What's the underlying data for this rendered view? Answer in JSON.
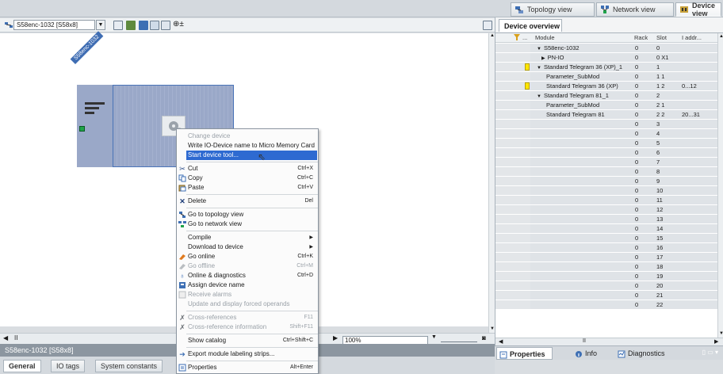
{
  "view_tabs": [
    {
      "label": "Topology view",
      "icon": "topology-icon",
      "active": false
    },
    {
      "label": "Network view",
      "icon": "network-icon",
      "active": false
    },
    {
      "label": "Device view",
      "icon": "device-icon",
      "active": true
    }
  ],
  "toolbar": {
    "device_selector": "S58enc-1032 [S58x8]",
    "icons": [
      "topology-icon",
      "overview-icon",
      "network-icon",
      "grid-icon",
      "table-icon",
      "layout-icon",
      "zoom-icon"
    ]
  },
  "canvas": {
    "device_name": "S58enc-1032",
    "zoom_value": "100%"
  },
  "context_menu": [
    {
      "label": "Change device",
      "disabled": true,
      "icon": "",
      "shortcut": ""
    },
    {
      "label": "Write IO-Device name to Micro Memory Card",
      "disabled": false,
      "icon": "",
      "shortcut": ""
    },
    {
      "label": "Start device tool...",
      "disabled": false,
      "icon": "",
      "shortcut": "",
      "highlighted": true
    },
    {
      "label": "Cut",
      "disabled": false,
      "icon": "cut-icon",
      "shortcut": "Ctrl+X"
    },
    {
      "label": "Copy",
      "disabled": false,
      "icon": "copy-icon",
      "shortcut": "Ctrl+C"
    },
    {
      "label": "Paste",
      "disabled": false,
      "icon": "paste-icon",
      "shortcut": "Ctrl+V"
    },
    {
      "label": "Delete",
      "disabled": false,
      "icon": "delete-icon",
      "shortcut": "Del"
    },
    {
      "label": "Go to topology view",
      "disabled": false,
      "icon": "topology-icon",
      "shortcut": ""
    },
    {
      "label": "Go to network view",
      "disabled": false,
      "icon": "network-icon",
      "shortcut": ""
    },
    {
      "label": "Compile",
      "disabled": false,
      "icon": "",
      "shortcut": "",
      "submenu": true
    },
    {
      "label": "Download to device",
      "disabled": false,
      "icon": "",
      "shortcut": "",
      "submenu": true
    },
    {
      "label": "Go online",
      "disabled": false,
      "icon": "go-online-icon",
      "shortcut": "Ctrl+K"
    },
    {
      "label": "Go offline",
      "disabled": true,
      "icon": "go-offline-icon",
      "shortcut": "Ctrl+M"
    },
    {
      "label": "Online & diagnostics",
      "disabled": false,
      "icon": "diagnostics-icon",
      "shortcut": "Ctrl+D"
    },
    {
      "label": "Assign device name",
      "disabled": false,
      "icon": "assign-name-icon",
      "shortcut": ""
    },
    {
      "label": "Receive alarms",
      "disabled": true,
      "icon": "alarm-icon",
      "shortcut": ""
    },
    {
      "label": "Update and display forced operands",
      "disabled": true,
      "icon": "",
      "shortcut": ""
    },
    {
      "label": "Cross-references",
      "disabled": true,
      "icon": "cross-ref-icon",
      "shortcut": "F11"
    },
    {
      "label": "Cross-reference information",
      "disabled": true,
      "icon": "cross-ref-info-icon",
      "shortcut": "Shift+F11"
    },
    {
      "label": "Show catalog",
      "disabled": false,
      "icon": "",
      "shortcut": "Ctrl+Shift+C"
    },
    {
      "label": "Export module labeling strips...",
      "disabled": false,
      "icon": "export-icon",
      "shortcut": ""
    },
    {
      "label": "Properties",
      "disabled": false,
      "icon": "properties-icon",
      "shortcut": "Alt+Enter"
    }
  ],
  "device_overview": {
    "tab_label": "Device overview",
    "columns": [
      "...",
      "Module",
      "Rack",
      "Slot",
      "I addr..."
    ],
    "rows": [
      {
        "module": "S58enc-1032",
        "rack": "0",
        "slot": "0",
        "addr": "",
        "indent": 1,
        "expander": "▼",
        "flag": false
      },
      {
        "module": "PN-IO",
        "rack": "0",
        "slot": "0 X1",
        "addr": "",
        "indent": 2,
        "expander": "▶",
        "flag": false
      },
      {
        "module": "Standard Telegram 36 (XP)_1",
        "rack": "0",
        "slot": "1",
        "addr": "",
        "indent": 1,
        "expander": "▼",
        "flag": true
      },
      {
        "module": "Parameter_SubMod",
        "rack": "0",
        "slot": "1 1",
        "addr": "",
        "indent": 3,
        "expander": "",
        "flag": false
      },
      {
        "module": "Standard Telegram 36 (XP)",
        "rack": "0",
        "slot": "1 2",
        "addr": "0...12",
        "indent": 3,
        "expander": "",
        "flag": true
      },
      {
        "module": "Standard Telegram 81_1",
        "rack": "0",
        "slot": "2",
        "addr": "",
        "indent": 1,
        "expander": "▼",
        "flag": false
      },
      {
        "module": "Parameter_SubMod",
        "rack": "0",
        "slot": "2 1",
        "addr": "",
        "indent": 3,
        "expander": "",
        "flag": false
      },
      {
        "module": "Standard Telegram 81",
        "rack": "0",
        "slot": "2 2",
        "addr": "20...31",
        "indent": 3,
        "expander": "",
        "flag": false
      },
      {
        "module": "",
        "rack": "0",
        "slot": "3",
        "addr": "",
        "indent": 0,
        "expander": "",
        "flag": false
      },
      {
        "module": "",
        "rack": "0",
        "slot": "4",
        "addr": "",
        "indent": 0,
        "expander": "",
        "flag": false
      },
      {
        "module": "",
        "rack": "0",
        "slot": "5",
        "addr": "",
        "indent": 0,
        "expander": "",
        "flag": false
      },
      {
        "module": "",
        "rack": "0",
        "slot": "6",
        "addr": "",
        "indent": 0,
        "expander": "",
        "flag": false
      },
      {
        "module": "",
        "rack": "0",
        "slot": "7",
        "addr": "",
        "indent": 0,
        "expander": "",
        "flag": false
      },
      {
        "module": "",
        "rack": "0",
        "slot": "8",
        "addr": "",
        "indent": 0,
        "expander": "",
        "flag": false
      },
      {
        "module": "",
        "rack": "0",
        "slot": "9",
        "addr": "",
        "indent": 0,
        "expander": "",
        "flag": false
      },
      {
        "module": "",
        "rack": "0",
        "slot": "10",
        "addr": "",
        "indent": 0,
        "expander": "",
        "flag": false
      },
      {
        "module": "",
        "rack": "0",
        "slot": "11",
        "addr": "",
        "indent": 0,
        "expander": "",
        "flag": false
      },
      {
        "module": "",
        "rack": "0",
        "slot": "12",
        "addr": "",
        "indent": 0,
        "expander": "",
        "flag": false
      },
      {
        "module": "",
        "rack": "0",
        "slot": "13",
        "addr": "",
        "indent": 0,
        "expander": "",
        "flag": false
      },
      {
        "module": "",
        "rack": "0",
        "slot": "14",
        "addr": "",
        "indent": 0,
        "expander": "",
        "flag": false
      },
      {
        "module": "",
        "rack": "0",
        "slot": "15",
        "addr": "",
        "indent": 0,
        "expander": "",
        "flag": false
      },
      {
        "module": "",
        "rack": "0",
        "slot": "16",
        "addr": "",
        "indent": 0,
        "expander": "",
        "flag": false
      },
      {
        "module": "",
        "rack": "0",
        "slot": "17",
        "addr": "",
        "indent": 0,
        "expander": "",
        "flag": false
      },
      {
        "module": "",
        "rack": "0",
        "slot": "18",
        "addr": "",
        "indent": 0,
        "expander": "",
        "flag": false
      },
      {
        "module": "",
        "rack": "0",
        "slot": "19",
        "addr": "",
        "indent": 0,
        "expander": "",
        "flag": false
      },
      {
        "module": "",
        "rack": "0",
        "slot": "20",
        "addr": "",
        "indent": 0,
        "expander": "",
        "flag": false
      },
      {
        "module": "",
        "rack": "0",
        "slot": "21",
        "addr": "",
        "indent": 0,
        "expander": "",
        "flag": false
      },
      {
        "module": "",
        "rack": "0",
        "slot": "22",
        "addr": "",
        "indent": 0,
        "expander": "",
        "flag": false
      }
    ]
  },
  "status_bar": {
    "title": "S58enc-1032 [S58x8]"
  },
  "bottom_tabs": [
    {
      "label": "General",
      "active": true
    },
    {
      "label": "IO tags",
      "active": false
    },
    {
      "label": "System constants",
      "active": false
    }
  ],
  "inspector_tabs": [
    {
      "label": "Properties",
      "icon": "properties-icon"
    },
    {
      "label": "Info",
      "icon": "info-icon"
    },
    {
      "label": "Diagnostics",
      "icon": "diagnostics-icon"
    }
  ],
  "colors": {
    "accent": "#2e6ad1",
    "device_fill": "#9aa8c8",
    "status_led": "#1fa34a",
    "flag_yellow": "#ffe600"
  }
}
